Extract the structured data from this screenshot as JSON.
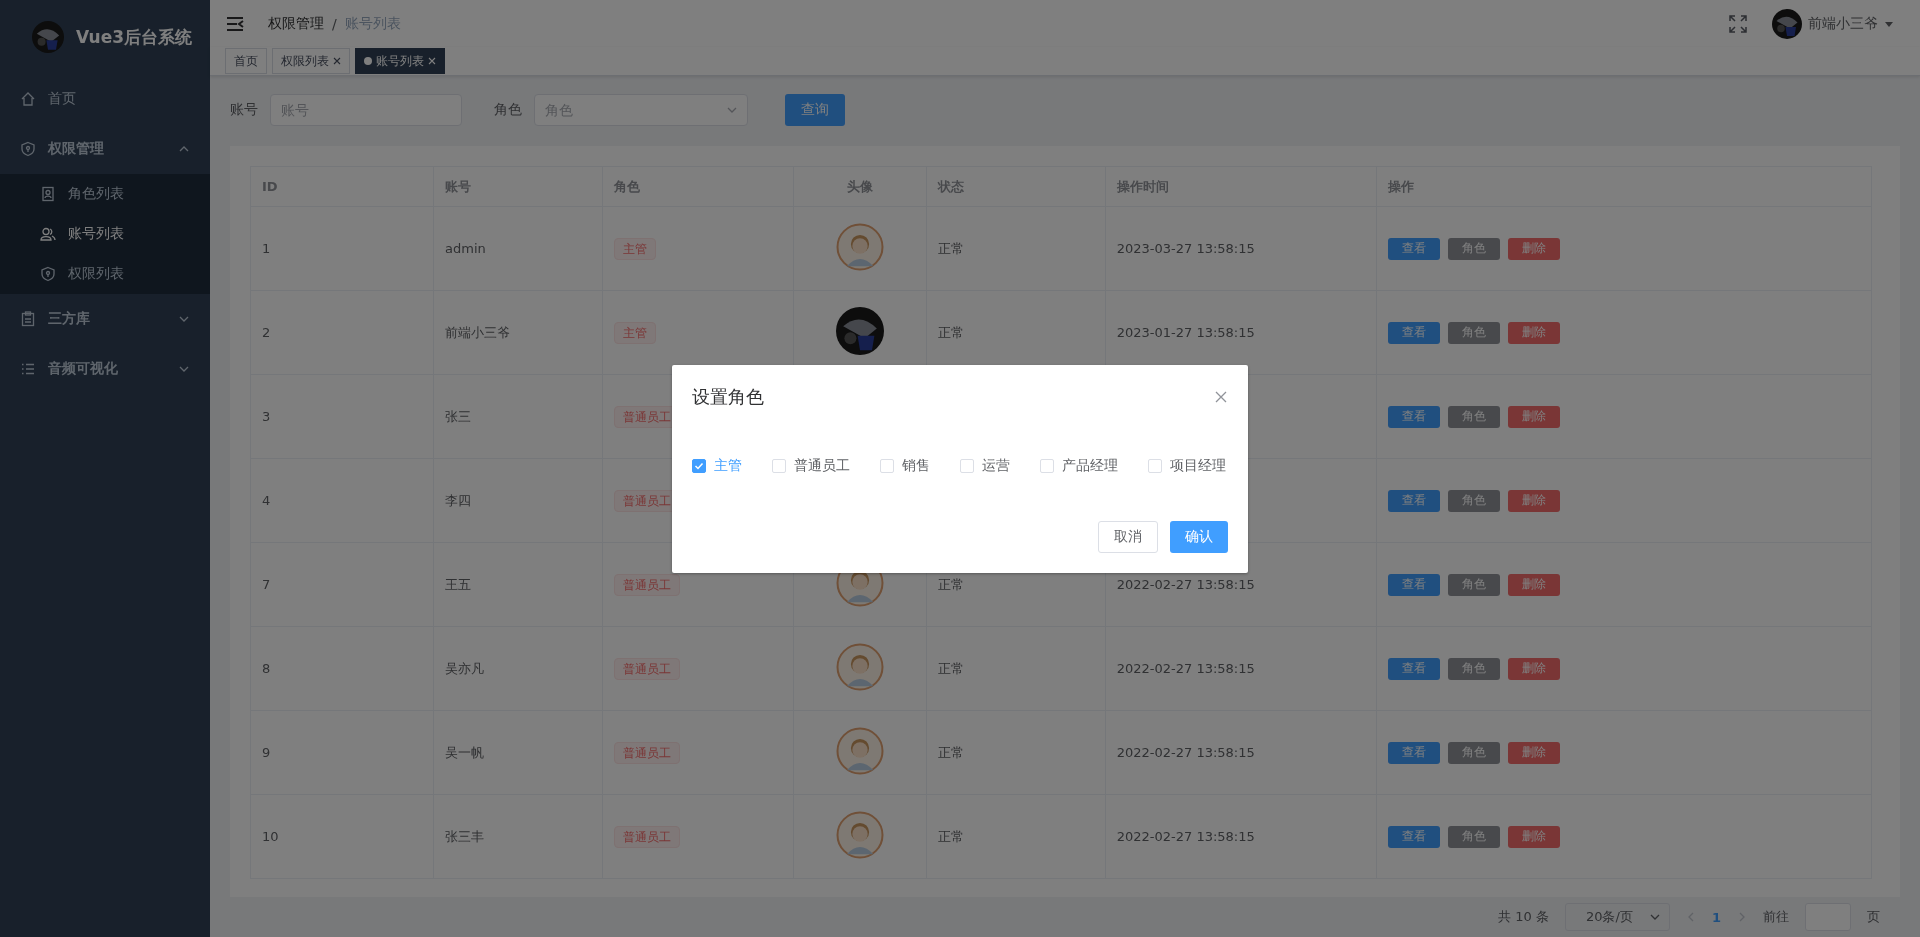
{
  "sidebar": {
    "title": "Vue3后台系统",
    "menu": [
      {
        "label": "首页",
        "selected": false
      },
      {
        "label": "权限管理",
        "expanded": true,
        "children": [
          {
            "label": "角色列表",
            "selected": false
          },
          {
            "label": "账号列表",
            "selected": true
          },
          {
            "label": "权限列表",
            "selected": false
          }
        ]
      },
      {
        "label": "三方库",
        "expanded": false
      },
      {
        "label": "音频可视化",
        "expanded": false
      }
    ]
  },
  "header": {
    "breadcrumb": [
      "权限管理",
      "账号列表"
    ],
    "breadcrumb_separator": "/",
    "user": "前端小三爷"
  },
  "tags": [
    {
      "label": "首页",
      "selected": false,
      "closable": false
    },
    {
      "label": "权限列表",
      "selected": false,
      "closable": true
    },
    {
      "label": "账号列表",
      "selected": true,
      "closable": true
    }
  ],
  "filter": {
    "fields": [
      {
        "label": "账号",
        "placeholder": "账号",
        "kind": "input"
      },
      {
        "label": "角色",
        "placeholder": "角色",
        "kind": "select"
      }
    ],
    "button": "查询"
  },
  "table": {
    "columns": [
      "ID",
      "账号",
      "角色",
      "头像",
      "状态",
      "操作时间",
      "操作"
    ],
    "rows": [
      {
        "id": "1",
        "account": "admin",
        "role": "主管",
        "avatar": {
          "kind": "picture"
        },
        "status": "正常",
        "time": "2023-03-27 13:58:15",
        "actions": [
          {
            "label": "查看",
            "kind": "primary"
          },
          {
            "label": "角色",
            "kind": "info"
          },
          {
            "label": "删除",
            "kind": "danger"
          }
        ]
      },
      {
        "id": "2",
        "account": "前端小三爷",
        "role": "主管",
        "avatar": {
          "kind": "picture"
        },
        "status": "正常",
        "time": "2023-01-27 13:58:15",
        "actions": [
          {
            "label": "查看",
            "kind": "primary"
          },
          {
            "label": "角色",
            "kind": "info"
          },
          {
            "label": "删除",
            "kind": "danger"
          }
        ]
      },
      {
        "id": "3",
        "account": "张三",
        "role": "普通员工",
        "actions": [
          {
            "label": "查看",
            "kind": "primary"
          },
          {
            "label": "角色",
            "kind": "info"
          },
          {
            "label": "删除",
            "kind": "danger"
          }
        ]
      },
      {
        "id": "4",
        "account": "李四",
        "role": "普通员工",
        "actions": [
          {
            "label": "查看",
            "kind": "primary"
          },
          {
            "label": "角色",
            "kind": "info"
          },
          {
            "label": "删除",
            "kind": "danger"
          }
        ]
      },
      {
        "id": "7",
        "account": "王五",
        "role": "普通员工",
        "avatar": {
          "kind": "picture"
        },
        "status": "正常",
        "time": "2022-02-27 13:58:15",
        "actions": [
          {
            "label": "查看",
            "kind": "primary"
          },
          {
            "label": "角色",
            "kind": "info"
          },
          {
            "label": "删除",
            "kind": "danger"
          }
        ]
      },
      {
        "id": "8",
        "account": "吴亦凡",
        "role": "普通员工",
        "avatar": {
          "kind": "picture"
        },
        "status": "正常",
        "time": "2022-02-27 13:58:15",
        "actions": [
          {
            "label": "查看",
            "kind": "primary"
          },
          {
            "label": "角色",
            "kind": "info"
          },
          {
            "label": "删除",
            "kind": "danger"
          }
        ]
      },
      {
        "id": "9",
        "account": "吴一帆",
        "role": "普通员工",
        "avatar": {
          "kind": "picture"
        },
        "status": "正常",
        "time": "2022-02-27 13:58:15",
        "actions": [
          {
            "label": "查看",
            "kind": "primary"
          },
          {
            "label": "角色",
            "kind": "info"
          },
          {
            "label": "删除",
            "kind": "danger"
          }
        ]
      },
      {
        "id": "10",
        "account": "张三丰",
        "role": "普通员工",
        "avatar": {
          "kind": "picture"
        },
        "status": "正常",
        "time": "2022-02-27 13:58:15",
        "actions": [
          {
            "label": "查看",
            "kind": "primary"
          },
          {
            "label": "角色",
            "kind": "info"
          },
          {
            "label": "删除",
            "kind": "danger"
          }
        ]
      }
    ]
  },
  "pagination": {
    "total": "共 10 条",
    "page_size": "20条/页",
    "current_page": "1",
    "goto": "前往",
    "goto_suffix": "页"
  },
  "dialog": {
    "title": "设置角色",
    "roles": [
      {
        "label": "主管",
        "checked": true
      },
      {
        "label": "普通员工",
        "checked": false
      },
      {
        "label": "销售",
        "checked": false
      },
      {
        "label": "运营",
        "checked": false
      },
      {
        "label": "产品经理",
        "checked": false
      },
      {
        "label": "项目经理",
        "checked": false
      }
    ],
    "buttons": [
      {
        "label": "取消",
        "kind": "default"
      },
      {
        "label": "确认",
        "kind": "primary"
      }
    ]
  }
}
